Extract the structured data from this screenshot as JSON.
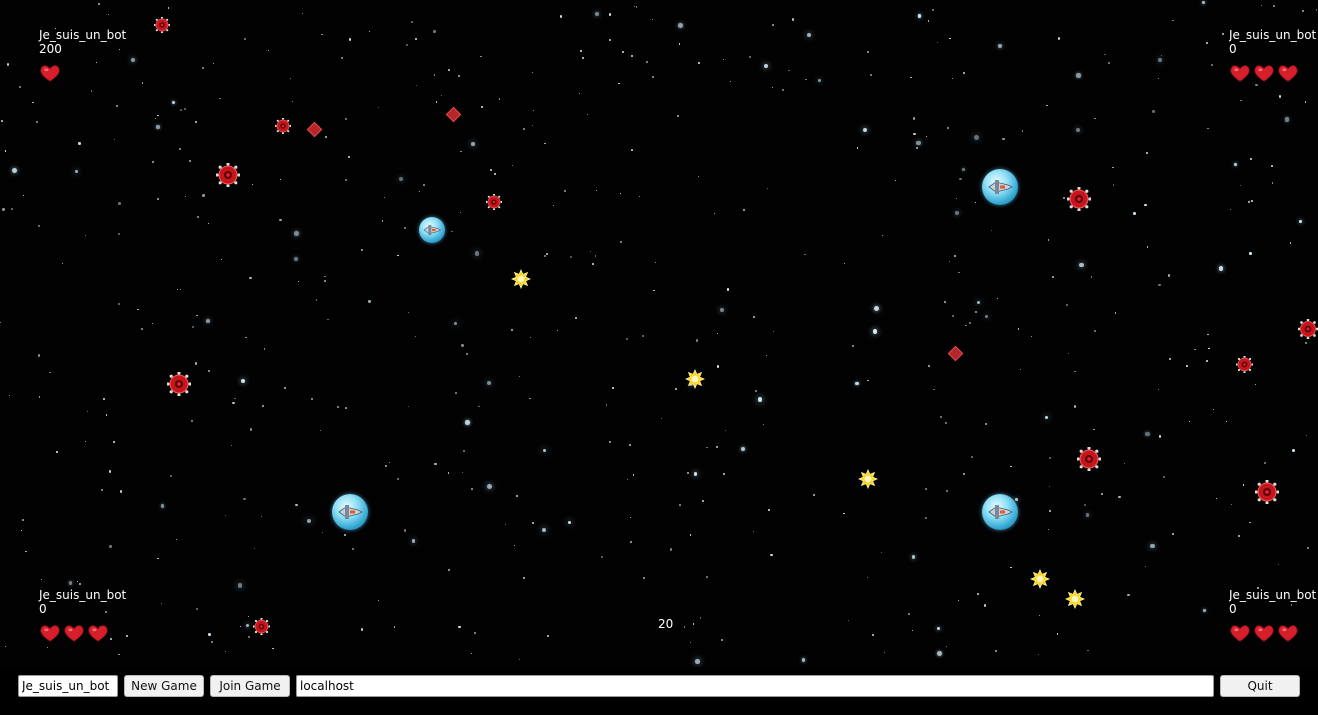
{
  "hud": {
    "top_left": {
      "name": "Je_suis_un_bot",
      "score": "200",
      "lives": 1
    },
    "top_right": {
      "name": "Je_suis_un_bot",
      "score": "0",
      "lives": 3
    },
    "bottom_left": {
      "name": "Je_suis_un_bot",
      "score": "0",
      "lives": 3
    },
    "bottom_right": {
      "name": "Je_suis_un_bot",
      "score": "0",
      "lives": 3
    }
  },
  "center_counter": "20",
  "controls": {
    "player_name_value": "Je_suis_un_bot",
    "new_game_label": "New Game",
    "join_game_label": "Join Game",
    "host_value": "localhost",
    "quit_label": "Quit"
  },
  "colors": {
    "background": "#000000",
    "heart": "#d61f2b",
    "mine": "#c4161c",
    "bonus": "#ffd21a",
    "ship_bubble": "#5cc8ea"
  },
  "icons": [
    "heart-icon",
    "mine-icon",
    "bonus-star-icon",
    "player-ship-icon"
  ]
}
